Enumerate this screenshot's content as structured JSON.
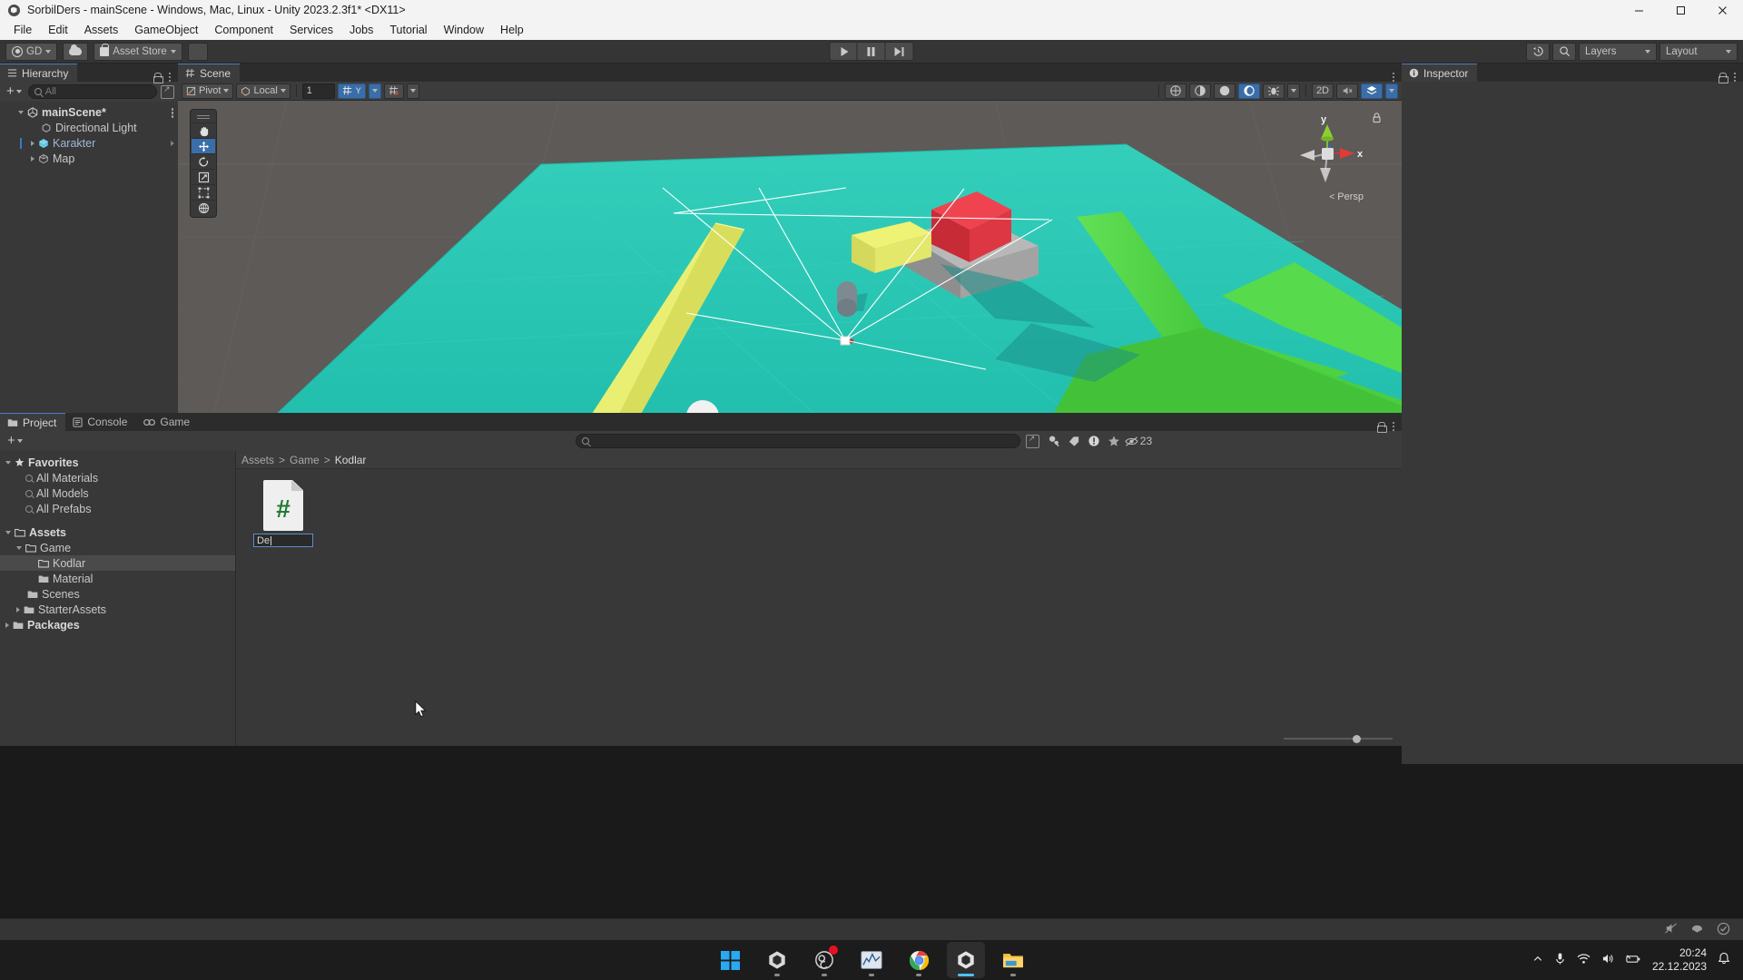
{
  "window": {
    "title": "SorbilDers - mainScene - Windows, Mac, Linux - Unity 2023.2.3f1* <DX11>",
    "minimize": "—",
    "maximize": "❐",
    "close": "✕"
  },
  "menu": [
    "File",
    "Edit",
    "Assets",
    "GameObject",
    "Component",
    "Services",
    "Jobs",
    "Tutorial",
    "Window",
    "Help"
  ],
  "toolbar": {
    "account": "GD",
    "asset_store": "Asset Store",
    "play": "play-button",
    "pause": "pause-button",
    "step": "step-button",
    "layers": "Layers",
    "layout": "Layout"
  },
  "hierarchy": {
    "tab": "Hierarchy",
    "search_placeholder": "All",
    "items": [
      {
        "label": "mainScene*",
        "icon": "unity-scene-icon",
        "depth": 0,
        "expanded": true,
        "bold": true
      },
      {
        "label": "Directional Light",
        "icon": "light-icon",
        "depth": 1
      },
      {
        "label": "Karakter",
        "icon": "prefab-cube-icon",
        "depth": 1,
        "highlighted": true
      },
      {
        "label": "Map",
        "icon": "cube-icon",
        "depth": 1
      }
    ]
  },
  "scene": {
    "tab": "Scene",
    "pivot": "Pivot",
    "local": "Local",
    "grid_size": "1",
    "two_d": "2D",
    "gizmo_axis_y": "y",
    "gizmo_axis_x": "x",
    "projection": "Persp",
    "tools": [
      "hand-tool",
      "move-tool",
      "rotate-tool",
      "scale-tool",
      "rect-tool",
      "transform-tool"
    ],
    "active_tool": "move-tool"
  },
  "inspector": {
    "tab": "Inspector"
  },
  "project": {
    "tabs": [
      {
        "label": "Project",
        "icon": "folder-icon",
        "active": true
      },
      {
        "label": "Console",
        "icon": "console-icon",
        "active": false
      },
      {
        "label": "Game",
        "icon": "gamepad-icon",
        "active": false
      }
    ],
    "breadcrumb": [
      "Assets",
      "Game",
      "Kodlar"
    ],
    "search_placeholder": "",
    "asset_count": "23",
    "tree": [
      {
        "label": "Favorites",
        "depth": 0,
        "icon": "star-icon",
        "expanded": true,
        "bold": true
      },
      {
        "label": "All Materials",
        "depth": 1,
        "icon": "search-icon"
      },
      {
        "label": "All Models",
        "depth": 1,
        "icon": "search-icon"
      },
      {
        "label": "All Prefabs",
        "depth": 1,
        "icon": "search-icon"
      },
      {
        "label": "Assets",
        "depth": 0,
        "icon": "folder-open-icon",
        "expanded": true,
        "bold": true
      },
      {
        "label": "Game",
        "depth": 1,
        "icon": "folder-open-icon",
        "expanded": true
      },
      {
        "label": "Kodlar",
        "depth": 2,
        "icon": "folder-icon",
        "selected": true
      },
      {
        "label": "Material",
        "depth": 2,
        "icon": "folder-icon"
      },
      {
        "label": "Scenes",
        "depth": 1,
        "icon": "folder-icon"
      },
      {
        "label": "StarterAssets",
        "depth": 1,
        "icon": "folder-icon",
        "collapsed": true
      },
      {
        "label": "Packages",
        "depth": 0,
        "icon": "folder-icon",
        "collapsed": true,
        "bold": true
      }
    ],
    "assets": [
      {
        "name_value": "De",
        "icon": "csharp-script-icon",
        "renaming": true
      }
    ]
  },
  "taskbar": {
    "apps": [
      {
        "name": "start-button"
      },
      {
        "name": "unity-hub-app"
      },
      {
        "name": "obs-app",
        "badge": true
      },
      {
        "name": "chart-app"
      },
      {
        "name": "chrome-app"
      },
      {
        "name": "unity-editor-app",
        "active": true
      },
      {
        "name": "file-explorer-app"
      }
    ],
    "time": "20:24",
    "date": "22.12.2023"
  },
  "colors": {
    "accent_blue": "#3a6ea8",
    "panel_bg": "#383838",
    "toolbar_bg": "#353535",
    "ground_teal": "#2fc4b2",
    "wall_yellow": "#e8ed6b",
    "ramp_green": "#56dd4c",
    "block_red": "#e0313c",
    "script_green": "#1f7a32"
  }
}
